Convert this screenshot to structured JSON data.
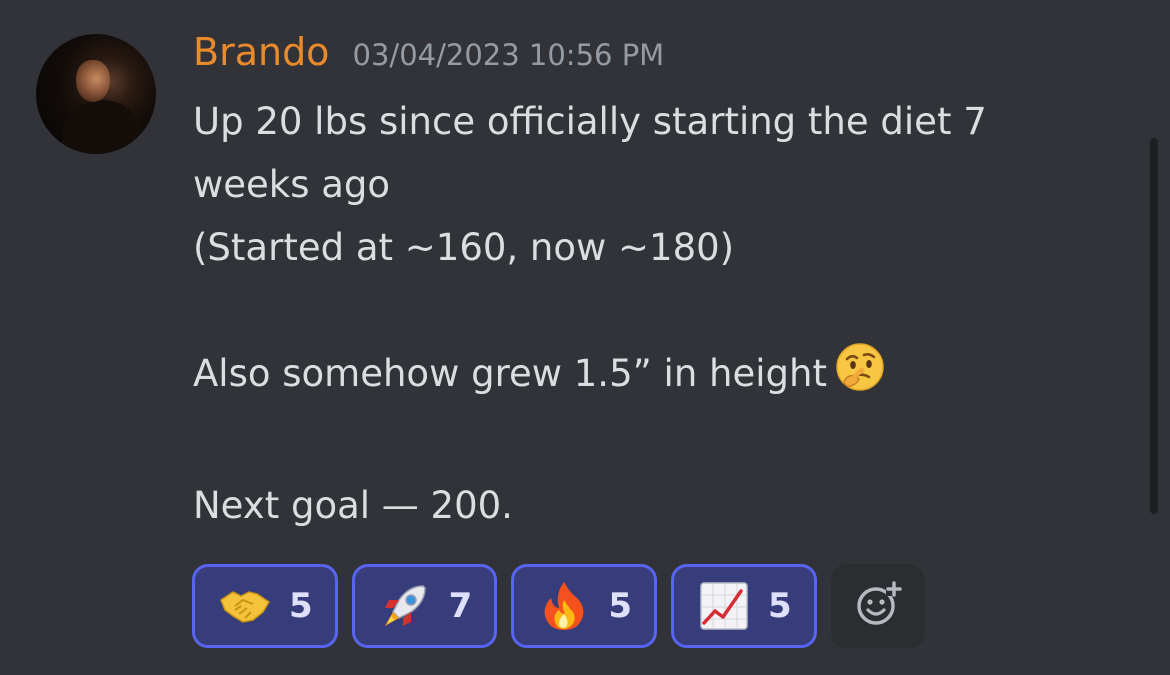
{
  "message": {
    "author": "Brando",
    "timestamp": "03/04/2023 10:56 PM",
    "lines": [
      "Up 20 lbs since officially starting the diet 7",
      "weeks ago",
      "(Started at ~160, now ~180)",
      "",
      "Also somehow grew 1.5” in height",
      "",
      "Next goal — 200."
    ],
    "inline_emoji": "thinking-face"
  },
  "reactions": [
    {
      "emoji": "handshake",
      "count": "5"
    },
    {
      "emoji": "rocket",
      "count": "7"
    },
    {
      "emoji": "fire",
      "count": "5"
    },
    {
      "emoji": "chart-increasing",
      "count": "5"
    }
  ],
  "colors": {
    "background": "#313338",
    "username": "#e98a2c",
    "reaction_border": "#5865f2",
    "reaction_fill": "#373d7a"
  }
}
